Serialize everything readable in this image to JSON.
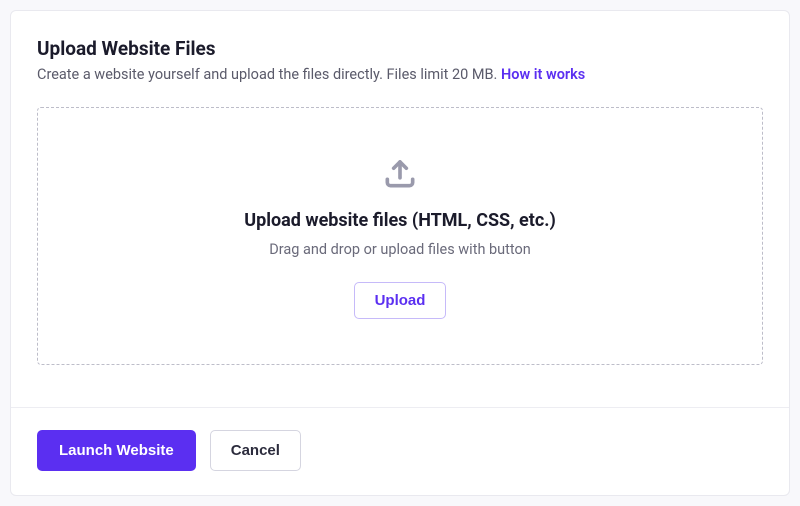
{
  "header": {
    "title": "Upload Website Files",
    "subtitle_prefix": "Create a website yourself and upload the files directly. Files limit 20 MB. ",
    "how_link": "How it works"
  },
  "dropzone": {
    "title": "Upload website files (HTML, CSS, etc.)",
    "hint": "Drag and drop or upload files with button",
    "upload_btn": "Upload"
  },
  "footer": {
    "launch": "Launch Website",
    "cancel": "Cancel"
  }
}
